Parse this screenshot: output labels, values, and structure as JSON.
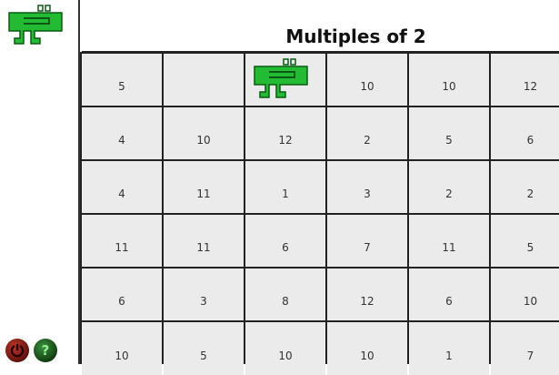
{
  "title": "Multiples of 2",
  "grid": [
    [
      "5",
      "",
      "",
      "10",
      "10",
      "12"
    ],
    [
      "4",
      "10",
      "12",
      "2",
      "5",
      "6"
    ],
    [
      "4",
      "11",
      "1",
      "3",
      "2",
      "2"
    ],
    [
      "11",
      "11",
      "6",
      "7",
      "11",
      "5"
    ],
    [
      "6",
      "3",
      "8",
      "12",
      "6",
      "10"
    ],
    [
      "10",
      "5",
      "10",
      "10",
      "1",
      "7"
    ]
  ],
  "player_position": {
    "row": 0,
    "col": 2
  },
  "colors": {
    "monster": "#22bb33",
    "monster_outline": "#0a5a12",
    "cell": "#ebebeb",
    "grid_line": "#222222"
  },
  "icons": {
    "sidebar": "green-muncher-icon",
    "quit": "quit-icon",
    "help": "help-icon"
  },
  "help_label": "?"
}
